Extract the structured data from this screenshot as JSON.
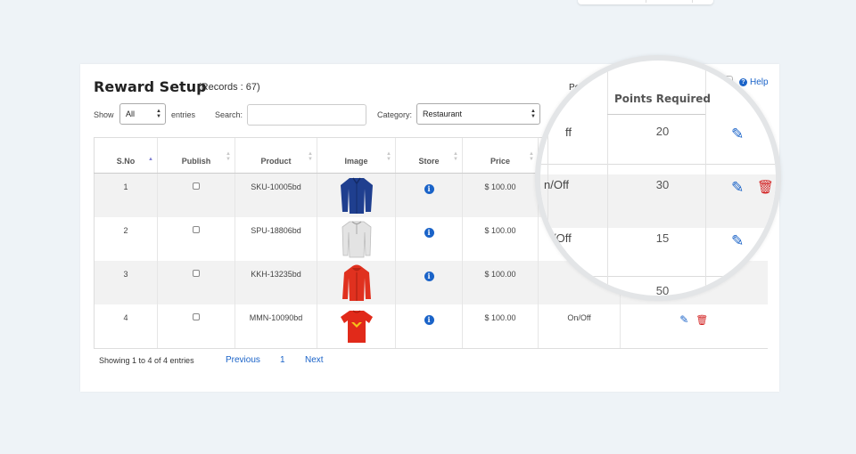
{
  "header": {
    "title": "Reward Setup",
    "records": "(Records : 67)",
    "points_label": "Points requi",
    "points_value": "20",
    "help": "Help"
  },
  "controls": {
    "show_label": "Show",
    "show_value": "All",
    "entries_label": "entries",
    "search_label": "Search:",
    "category_label": "Category:",
    "category_value": "Restaurant"
  },
  "table": {
    "columns": [
      "S.No",
      "Publish",
      "Product",
      "Image",
      "Store",
      "Price",
      "",
      ""
    ],
    "rows": [
      {
        "sno": "1",
        "product": "SKU-10005bd",
        "price": "$ 100.00",
        "onoff": ""
      },
      {
        "sno": "2",
        "product": "SPU-18806bd",
        "price": "$ 100.00",
        "onoff": ""
      },
      {
        "sno": "3",
        "product": "KKH-13235bd",
        "price": "$ 100.00",
        "onoff": ""
      },
      {
        "sno": "4",
        "product": "MMN-10090bd",
        "price": "$ 100.00",
        "onoff": "On/Off"
      }
    ]
  },
  "footer": {
    "showing": "Showing 1 to 4 of 4 entries",
    "previous": "Previous",
    "page": "1",
    "next": "Next"
  },
  "magnifier": {
    "header": "Points Required",
    "values": [
      "20",
      "30",
      "15",
      "50"
    ],
    "onoff_top": "ff",
    "onoff_row1": "n/Off",
    "onoff_row2": "/Off"
  },
  "icons": {
    "info": "info-icon",
    "edit": "pencil-icon",
    "delete": "trash-icon",
    "help": "question-circle-icon",
    "sort": "sort-arrows-icon"
  },
  "colors": {
    "accent": "#1a63c8",
    "danger": "#d21e1e",
    "background": "#eef3f7"
  }
}
